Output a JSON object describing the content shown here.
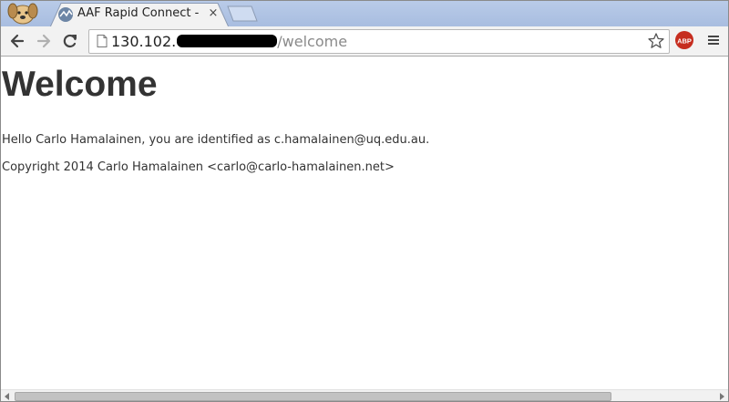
{
  "browser": {
    "tab": {
      "title": "AAF Rapid Connect - R",
      "close_label": "×"
    },
    "address_bar": {
      "host_visible": "130.102.",
      "path": "/welcome"
    },
    "extension": {
      "label": "ABP"
    }
  },
  "page": {
    "heading": "Welcome",
    "greeting": "Hello Carlo Hamalainen, you are identified as c.hamalainen@uq.edu.au.",
    "copyright": "Copyright 2014 Carlo Hamalainen <carlo@carlo-hamalainen.net>"
  },
  "colors": {
    "tabstrip": "#a8bde0",
    "toolbar": "#f2f2f2",
    "abp_red": "#c62d1f",
    "text": "#333333"
  },
  "icons": {
    "profile": "dog-avatar-icon",
    "favicon": "aaf-favicon-icon",
    "back": "back-arrow-icon",
    "forward": "forward-arrow-icon",
    "reload": "reload-icon",
    "page": "page-icon",
    "bookmark": "star-icon",
    "menu": "hamburger-menu-icon"
  }
}
